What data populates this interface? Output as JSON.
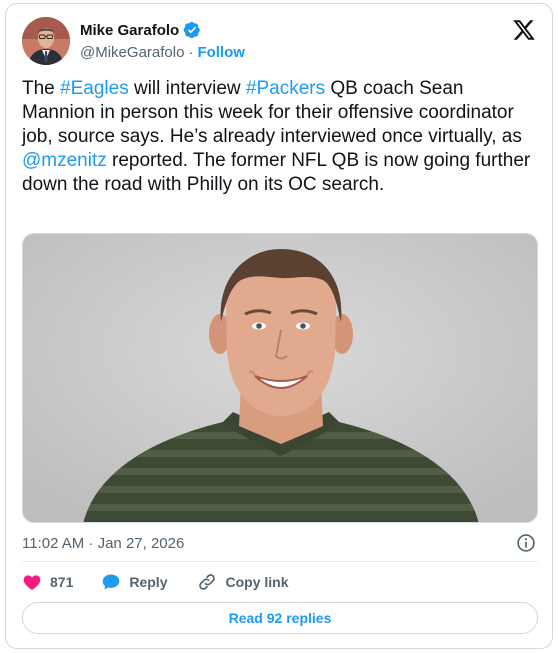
{
  "author": {
    "name": "Mike Garafolo",
    "handle": "@MikeGarafolo",
    "separator": "·",
    "follow_label": "Follow",
    "verified": true
  },
  "tweet": {
    "segments": [
      {
        "text": "The ",
        "link": false
      },
      {
        "text": "#Eagles",
        "link": true
      },
      {
        "text": " will interview ",
        "link": false
      },
      {
        "text": "#Packers",
        "link": true
      },
      {
        "text": " QB coach Sean Mannion in person this week for their offensive coordinator job, source says. He’s already interviewed once virtually, as ",
        "link": false
      },
      {
        "text": "@mzenitz",
        "link": true
      },
      {
        "text": " reported. The former NFL QB is now going further down the road with Philly on its OC search.",
        "link": false
      }
    ]
  },
  "media": {
    "icon": "portrait-photo"
  },
  "meta": {
    "timestamp": "11:02 AM · Jan 27, 2026"
  },
  "actions": {
    "like_count": "871",
    "reply_label": "Reply",
    "copy_link_label": "Copy link"
  },
  "footer": {
    "read_replies_label": "Read 92 replies"
  },
  "colors": {
    "accent": "#1d9bf0",
    "like": "#f91880",
    "text": "#0f1419",
    "muted": "#536471"
  }
}
